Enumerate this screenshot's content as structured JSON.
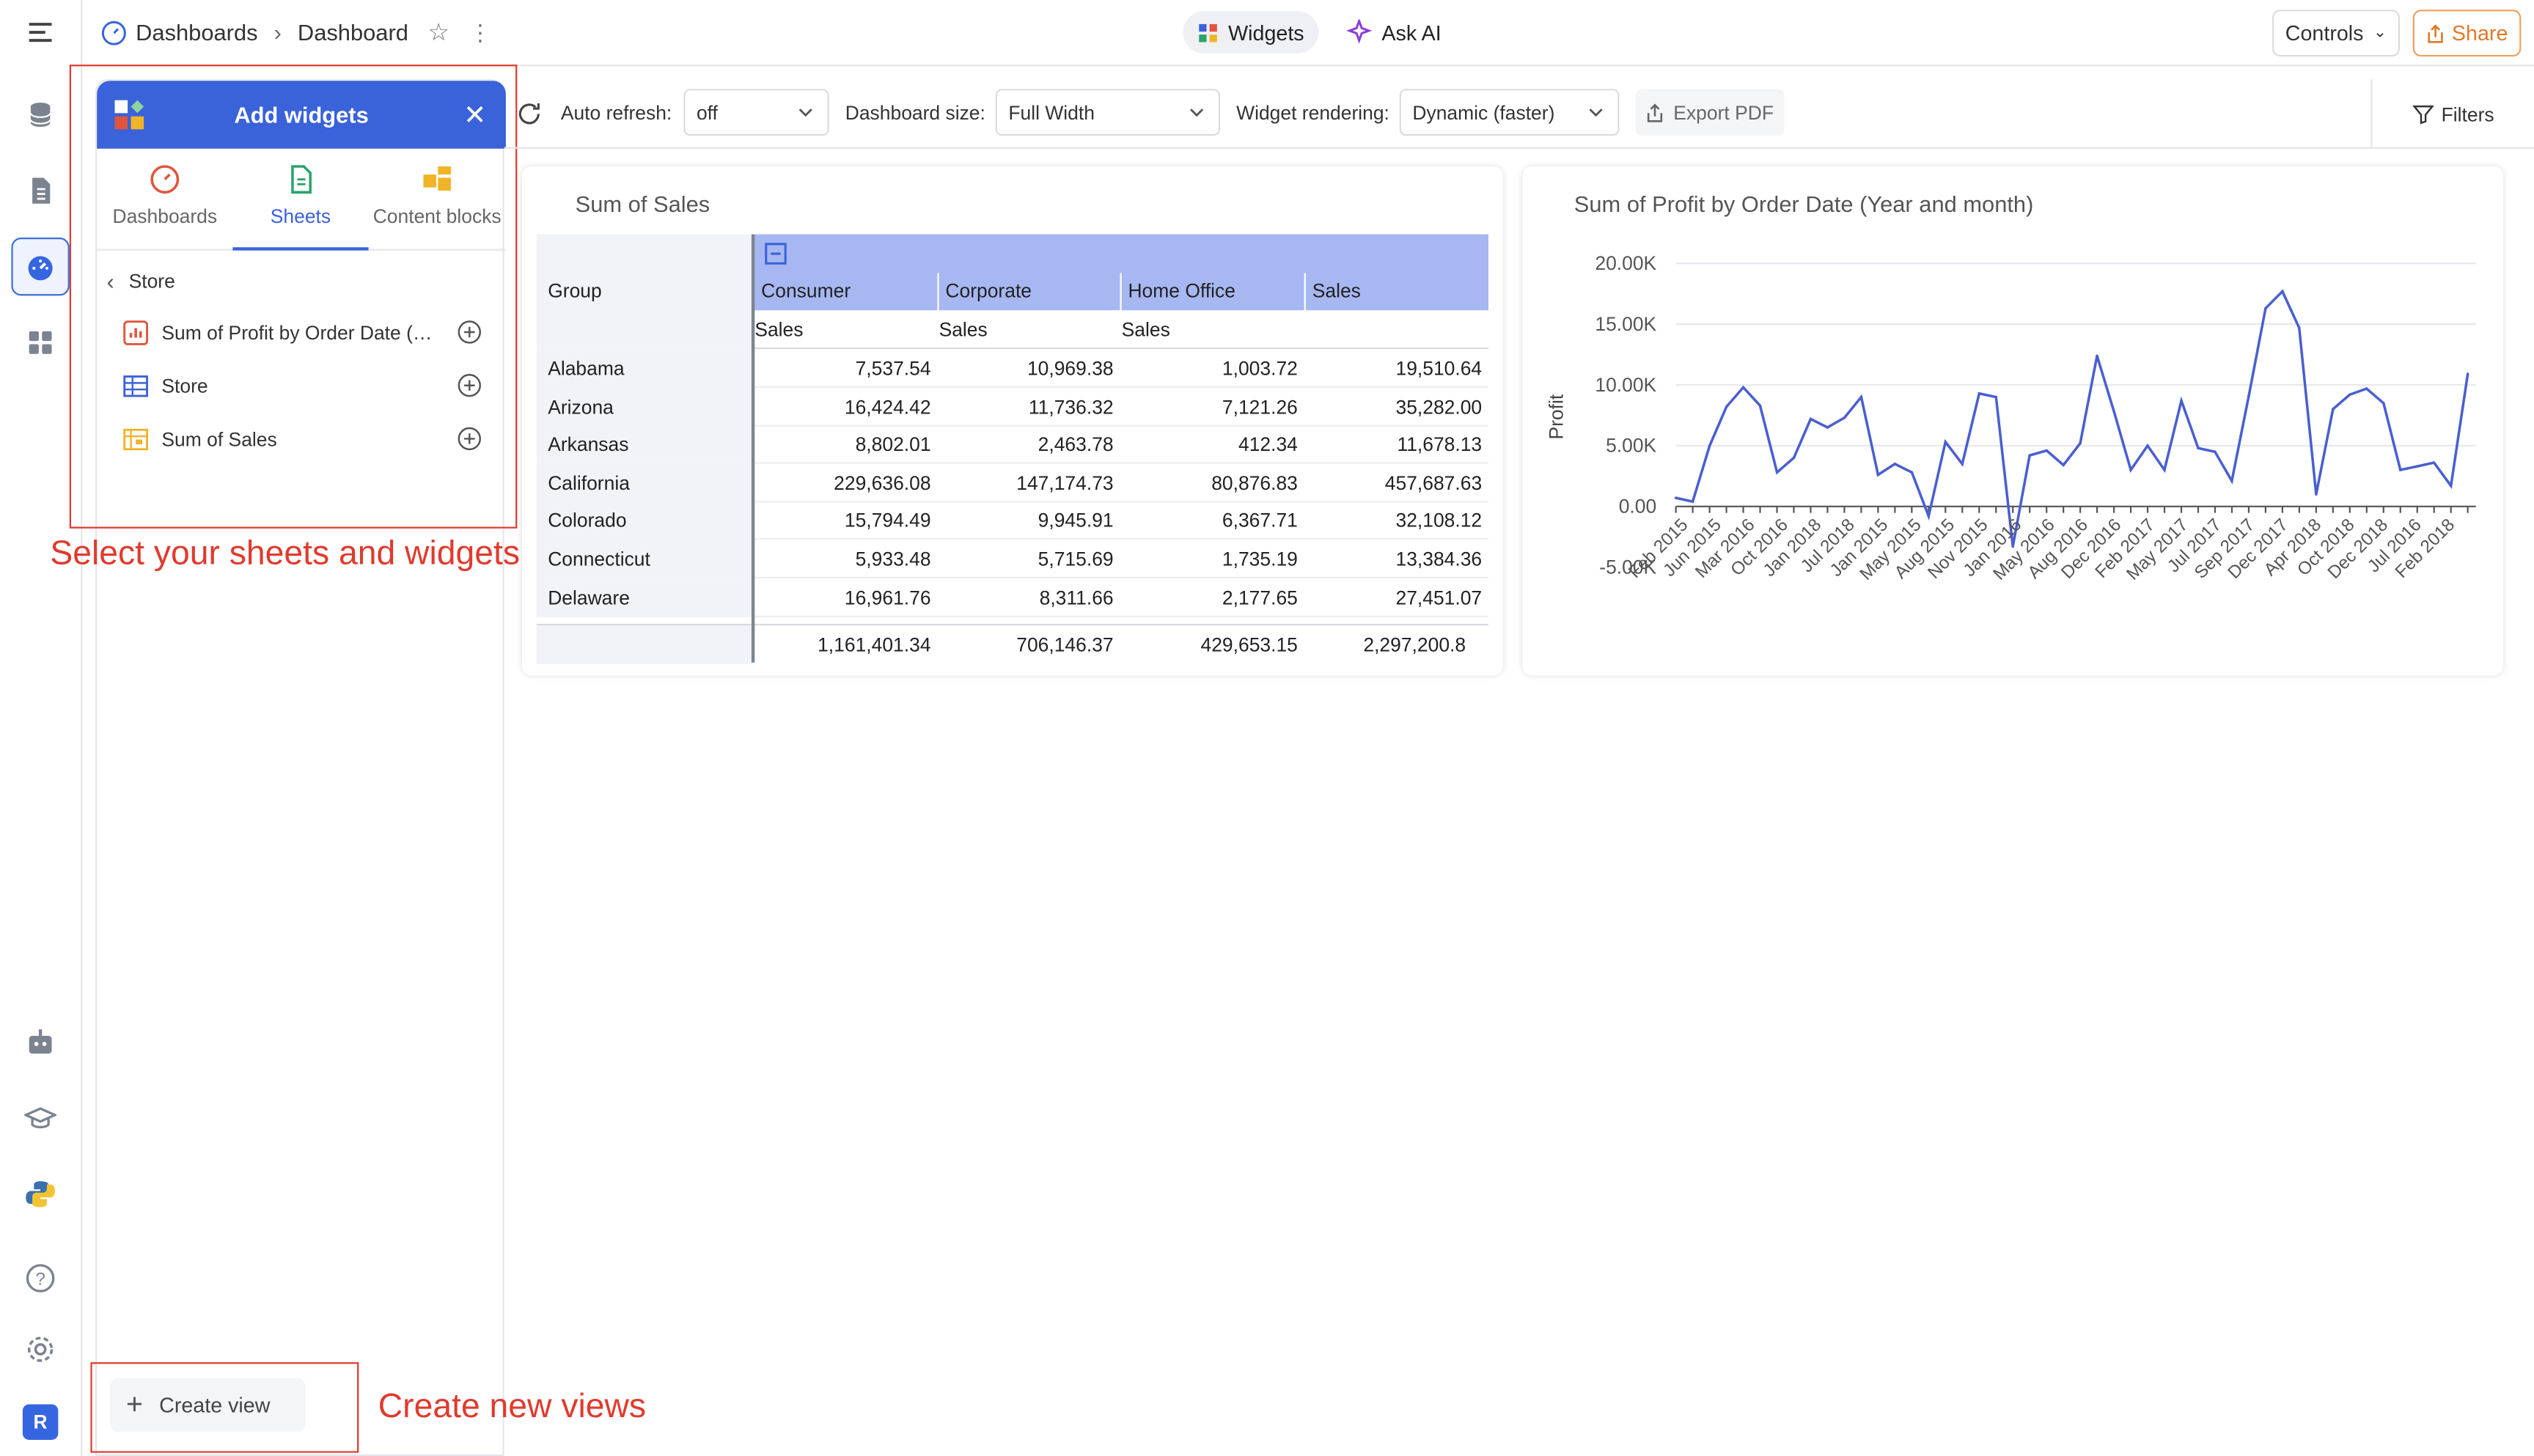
{
  "topbar": {
    "breadcrumb_root": "Dashboards",
    "breadcrumb_current": "Dashboard",
    "tabs": [
      {
        "label": "Widgets",
        "active": true
      },
      {
        "label": "Ask AI",
        "active": false
      }
    ],
    "controls_label": "Controls",
    "share_label": "Share"
  },
  "panel": {
    "title": "Add widgets",
    "tabs": [
      {
        "label": "Dashboards",
        "active": false
      },
      {
        "label": "Sheets",
        "active": true
      },
      {
        "label": "Content blocks",
        "active": false
      }
    ],
    "back_label": "Store",
    "items": [
      {
        "label": "Sum of Profit by Order Date (Year and month)",
        "icon": "bar-chart-icon"
      },
      {
        "label": "Store",
        "icon": "table-icon"
      },
      {
        "label": "Sum of Sales",
        "icon": "pivot-icon"
      }
    ],
    "create_view_label": "Create view"
  },
  "annotations": {
    "select_text": "Select your sheets and widgets",
    "create_text": "Create new views"
  },
  "toolbar": {
    "auto_refresh_label": "Auto refresh:",
    "auto_refresh_value": "off",
    "dashboard_size_label": "Dashboard size:",
    "dashboard_size_value": "Full Width",
    "widget_rendering_label": "Widget rendering:",
    "widget_rendering_value": "Dynamic (faster)",
    "export_label": "Export PDF",
    "filters_label": "Filters"
  },
  "pivot": {
    "title": "Sum of Sales",
    "group_header": "Group",
    "columns": [
      "Consumer",
      "Corporate",
      "Home Office",
      "Sales"
    ],
    "subheaders": [
      "Sales",
      "Sales",
      "Sales",
      ""
    ],
    "rows": [
      {
        "group": "Alabama",
        "values": [
          "7,537.54",
          "10,969.38",
          "1,003.72",
          "19,510.64"
        ]
      },
      {
        "group": "Arizona",
        "values": [
          "16,424.42",
          "11,736.32",
          "7,121.26",
          "35,282.00"
        ]
      },
      {
        "group": "Arkansas",
        "values": [
          "8,802.01",
          "2,463.78",
          "412.34",
          "11,678.13"
        ]
      },
      {
        "group": "California",
        "values": [
          "229,636.08",
          "147,174.73",
          "80,876.83",
          "457,687.63"
        ]
      },
      {
        "group": "Colorado",
        "values": [
          "15,794.49",
          "9,945.91",
          "6,367.71",
          "32,108.12"
        ]
      },
      {
        "group": "Connecticut",
        "values": [
          "5,933.48",
          "5,715.69",
          "1,735.19",
          "13,384.36"
        ]
      },
      {
        "group": "Delaware",
        "values": [
          "16,961.76",
          "8,311.66",
          "2,177.65",
          "27,451.07"
        ]
      }
    ],
    "totals": [
      "1,161,401.34",
      "706,146.37",
      "429,653.15",
      "2,297,200.8"
    ]
  },
  "chart_data": {
    "type": "line",
    "title": "Sum of Profit by Order Date (Year and month)",
    "xlabel": "",
    "ylabel": "Profit",
    "ylim": [
      -5000,
      20000
    ],
    "yticks": [
      "20.00K",
      "15.00K",
      "10.00K",
      "5.00K",
      "0.00",
      "-5.00K"
    ],
    "ytick_values": [
      20000,
      15000,
      10000,
      5000,
      0,
      -5000
    ],
    "xtick_labels": [
      "Feb 2015",
      "Jun 2015",
      "Mar 2016",
      "Oct 2016",
      "Jan 2018",
      "Jul 2018",
      "Jan 2015",
      "May 2015",
      "Aug 2015",
      "Nov 2015",
      "Jan 2016",
      "May 2016",
      "Aug 2016",
      "Dec 2016",
      "Feb 2017",
      "May 2017",
      "Jul 2017",
      "Sep 2017",
      "Dec 2017",
      "Apr 2018",
      "Oct 2018",
      "Dec 2018",
      "Jul 2016",
      "Feb 2018"
    ],
    "color": "#4a5fd0",
    "series": [
      {
        "values": [
          700,
          400,
          5000,
          8200,
          9800,
          8300,
          2800,
          4000,
          7200,
          6500,
          7300,
          9000,
          2600,
          3500,
          2800,
          -800,
          5300,
          3500,
          9300,
          9000,
          -3300,
          4200,
          4600,
          3400,
          5200,
          12400,
          7800,
          3000,
          5000,
          3000,
          8700,
          4800,
          4500,
          2100,
          9100,
          16300,
          17700,
          14700,
          1000,
          8000,
          9200,
          9700,
          8500,
          3000,
          3300,
          3600,
          1700,
          10900
        ]
      }
    ],
    "grid": true
  }
}
